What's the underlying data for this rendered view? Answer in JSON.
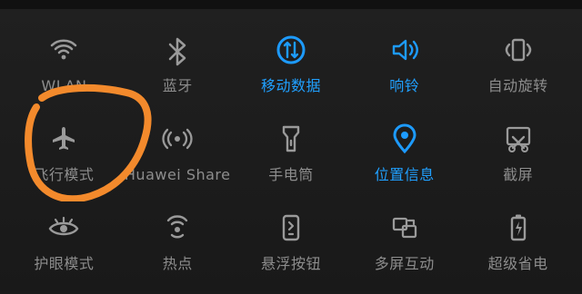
{
  "quick_settings": {
    "row1": [
      {
        "label": "WLAN",
        "icon": "wifi-icon",
        "active": false
      },
      {
        "label": "蓝牙",
        "icon": "bluetooth-icon",
        "active": false
      },
      {
        "label": "移动数据",
        "icon": "mobile-data-icon",
        "active": true
      },
      {
        "label": "响铃",
        "icon": "ringer-icon",
        "active": true
      },
      {
        "label": "自动旋转",
        "icon": "auto-rotate-icon",
        "active": false
      }
    ],
    "row2": [
      {
        "label": "飞行模式",
        "icon": "airplane-icon",
        "active": false
      },
      {
        "label": "Huawei Share",
        "icon": "huawei-share-icon",
        "active": false
      },
      {
        "label": "手电筒",
        "icon": "flashlight-icon",
        "active": false
      },
      {
        "label": "位置信息",
        "icon": "location-icon",
        "active": true
      },
      {
        "label": "截屏",
        "icon": "screenshot-icon",
        "active": false
      }
    ],
    "row3": [
      {
        "label": "护眼模式",
        "icon": "eye-comfort-icon",
        "active": false
      },
      {
        "label": "热点",
        "icon": "hotspot-icon",
        "active": false
      },
      {
        "label": "悬浮按钮",
        "icon": "floating-button-icon",
        "active": false
      },
      {
        "label": "多屏互动",
        "icon": "multi-screen-icon",
        "active": false
      },
      {
        "label": "超级省电",
        "icon": "battery-saver-icon",
        "active": false
      }
    ]
  },
  "colors": {
    "background": "#1b1b1b",
    "inactive": "#8d8d8d",
    "active": "#1d9bff",
    "annotation": "#f38a2c"
  }
}
